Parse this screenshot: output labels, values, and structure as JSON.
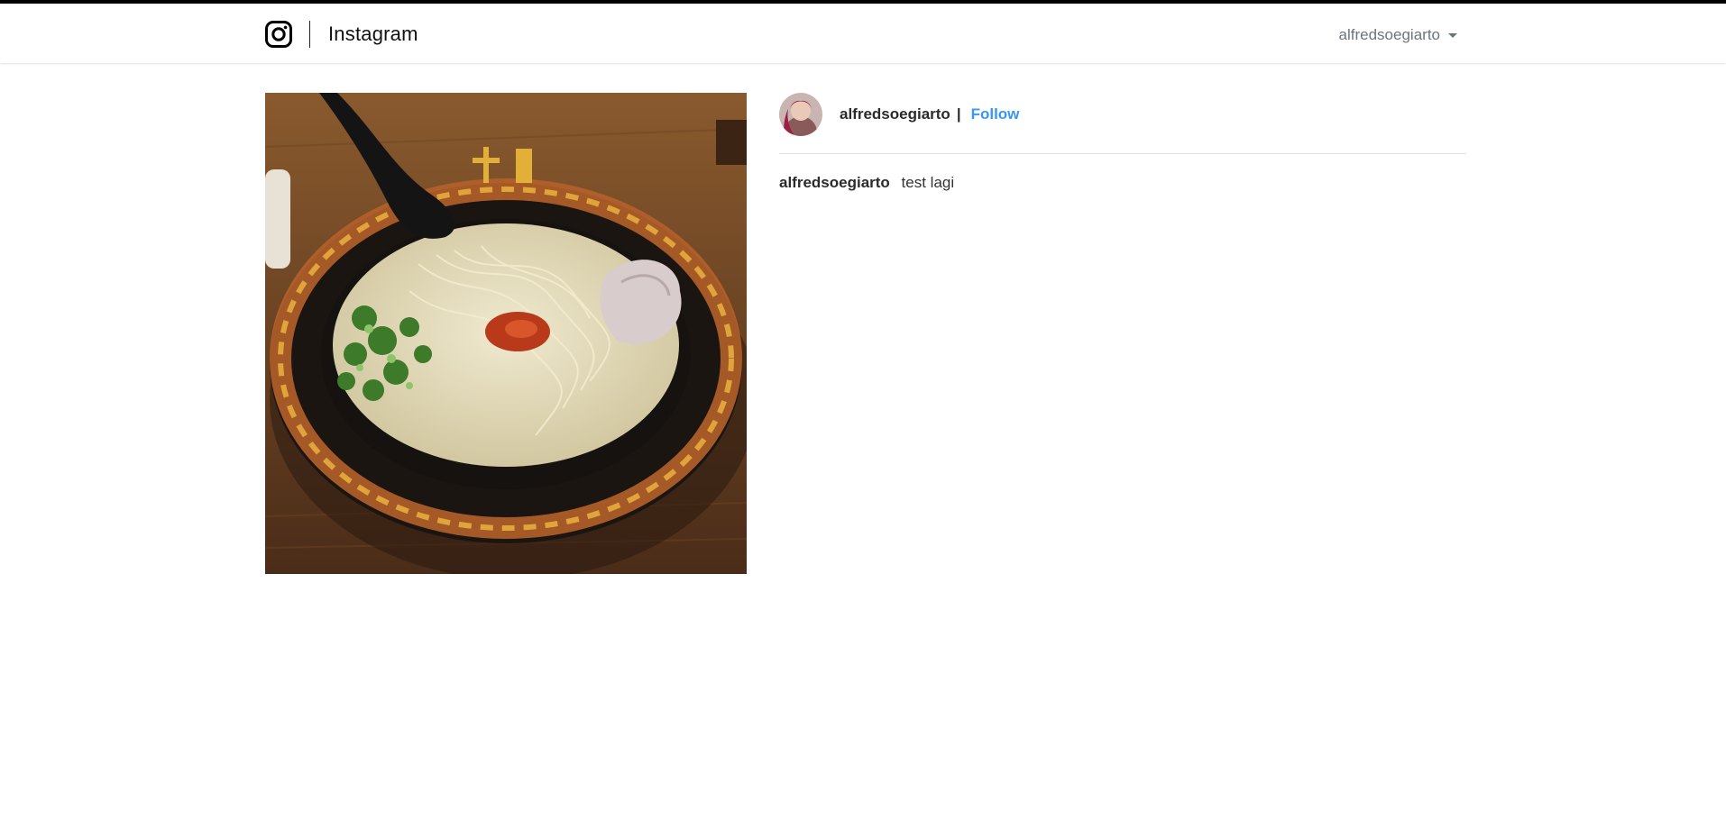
{
  "navbar": {
    "brand_icon": "instagram-icon",
    "brand_text": "Instagram",
    "user_menu_label": "alfredsoegiarto",
    "user_menu_icon": "chevron-down-icon"
  },
  "post": {
    "image_icon": "ramen-bowl-photo",
    "author": "alfredsoegiarto",
    "separator": "|",
    "follow_label": "Follow",
    "caption_user": "alfredsoegiarto",
    "caption_text": "test lagi"
  },
  "colors": {
    "link": "#3897f0",
    "nav_text": "#6c757d",
    "top_border": "#000000"
  }
}
